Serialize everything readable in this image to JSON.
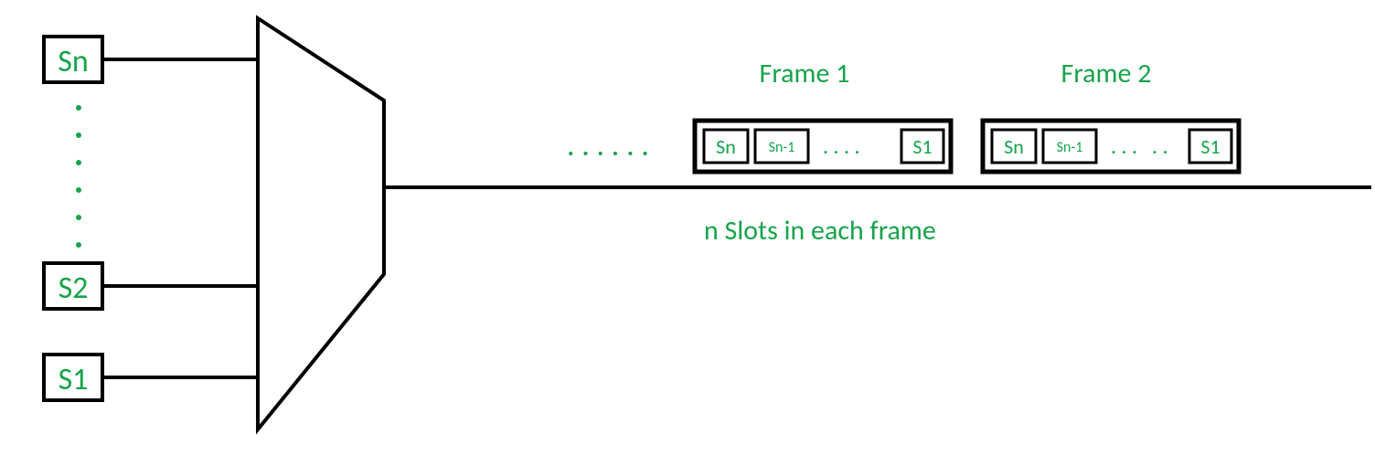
{
  "sources": {
    "top": "Sn",
    "mid": "S2",
    "bot": "S1"
  },
  "frames": {
    "frame1_label": "Frame 1",
    "frame2_label": "Frame 2",
    "slot_first": "Sn",
    "slot_second": "Sn-1",
    "slot_last": "S1"
  },
  "caption": "n Slots in each frame",
  "ellipsis": {
    "dot6": ". . . . . .",
    "dot4": ". . . .",
    "dot3": ". . .",
    "dot2": ". ."
  }
}
